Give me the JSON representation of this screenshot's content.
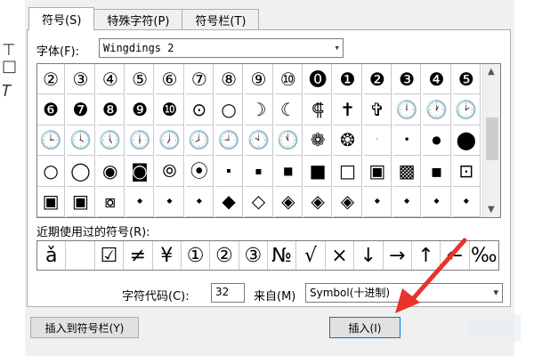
{
  "tabs": [
    {
      "label": "符号(S)",
      "active": true
    },
    {
      "label": "特殊字符(P)",
      "active": false
    },
    {
      "label": "符号栏(T)",
      "active": false
    }
  ],
  "font": {
    "label": "字体(F):",
    "value": "Wingdings 2"
  },
  "symbol_grid": [
    {
      "ch": "②"
    },
    {
      "ch": "③"
    },
    {
      "ch": "④"
    },
    {
      "ch": "⑤"
    },
    {
      "ch": "⑥"
    },
    {
      "ch": "⑦"
    },
    {
      "ch": "⑧"
    },
    {
      "ch": "⑨"
    },
    {
      "ch": "⑩"
    },
    {
      "ch": "⓿"
    },
    {
      "ch": "❶"
    },
    {
      "ch": "❷"
    },
    {
      "ch": "❸"
    },
    {
      "ch": "❹"
    },
    {
      "ch": "❺"
    },
    {
      "ch": "❻"
    },
    {
      "ch": "❼"
    },
    {
      "ch": "❽"
    },
    {
      "ch": "❾"
    },
    {
      "ch": "❿"
    },
    {
      "ch": "⊙"
    },
    {
      "ch": "○"
    },
    {
      "ch": "☽"
    },
    {
      "ch": "☾"
    },
    {
      "ch": "⸿"
    },
    {
      "ch": "✝"
    },
    {
      "ch": "✞"
    },
    {
      "ch": "🕛"
    },
    {
      "ch": "🕐"
    },
    {
      "ch": "🕑"
    },
    {
      "ch": "🕒"
    },
    {
      "ch": "🕓"
    },
    {
      "ch": "🕔"
    },
    {
      "ch": "🕕"
    },
    {
      "ch": "🕖"
    },
    {
      "ch": "🕗"
    },
    {
      "ch": "🕘"
    },
    {
      "ch": "🕙"
    },
    {
      "ch": "🕚"
    },
    {
      "ch": "❁"
    },
    {
      "ch": "❂"
    },
    {
      "ch": "·",
      "size": "sm"
    },
    {
      "ch": "•",
      "size": "md"
    },
    {
      "ch": "●",
      "size": "md"
    },
    {
      "ch": "⬤"
    },
    {
      "ch": "○"
    },
    {
      "ch": "◯"
    },
    {
      "ch": "◉"
    },
    {
      "ch": "◙"
    },
    {
      "ch": "⦾"
    },
    {
      "ch": "⦿"
    },
    {
      "ch": "▪",
      "size": "sm"
    },
    {
      "ch": "▪",
      "size": "md"
    },
    {
      "ch": "■",
      "size": "md"
    },
    {
      "ch": "■"
    },
    {
      "ch": "□"
    },
    {
      "ch": "▣"
    },
    {
      "ch": "▩"
    },
    {
      "ch": "▪"
    },
    {
      "ch": "⊡"
    },
    {
      "ch": "▣"
    },
    {
      "ch": "▣"
    },
    {
      "ch": "⧇"
    },
    {
      "ch": "◆",
      "size": "sm"
    },
    {
      "ch": "◆",
      "size": "sm"
    },
    {
      "ch": "◆",
      "size": "sm"
    },
    {
      "ch": "◆"
    },
    {
      "ch": "◇"
    },
    {
      "ch": "◈"
    },
    {
      "ch": "◈"
    },
    {
      "ch": "◈"
    },
    {
      "ch": "◆",
      "size": "sm"
    },
    {
      "ch": "◆",
      "size": "sm"
    },
    {
      "ch": "◆",
      "size": "sm"
    },
    {
      "ch": "◆",
      "size": "sm"
    }
  ],
  "recent": {
    "label": "近期使用过的符号(R):",
    "items": [
      "ǎ",
      "",
      "☑",
      "≠",
      "¥",
      "①",
      "②",
      "③",
      "№",
      "√",
      "×",
      "↓",
      "→",
      "↑",
      "←",
      "‰"
    ]
  },
  "char_code": {
    "label": "字符代码(C):",
    "value": "32"
  },
  "from": {
    "label": "来自(M)",
    "value": "Symbol(十进制)"
  },
  "buttons": {
    "to_toolbar": "插入到符号栏(Y)",
    "insert": "插入(I)"
  },
  "colors": {
    "accent": "#0078d7",
    "arrow": "#e8332a"
  }
}
